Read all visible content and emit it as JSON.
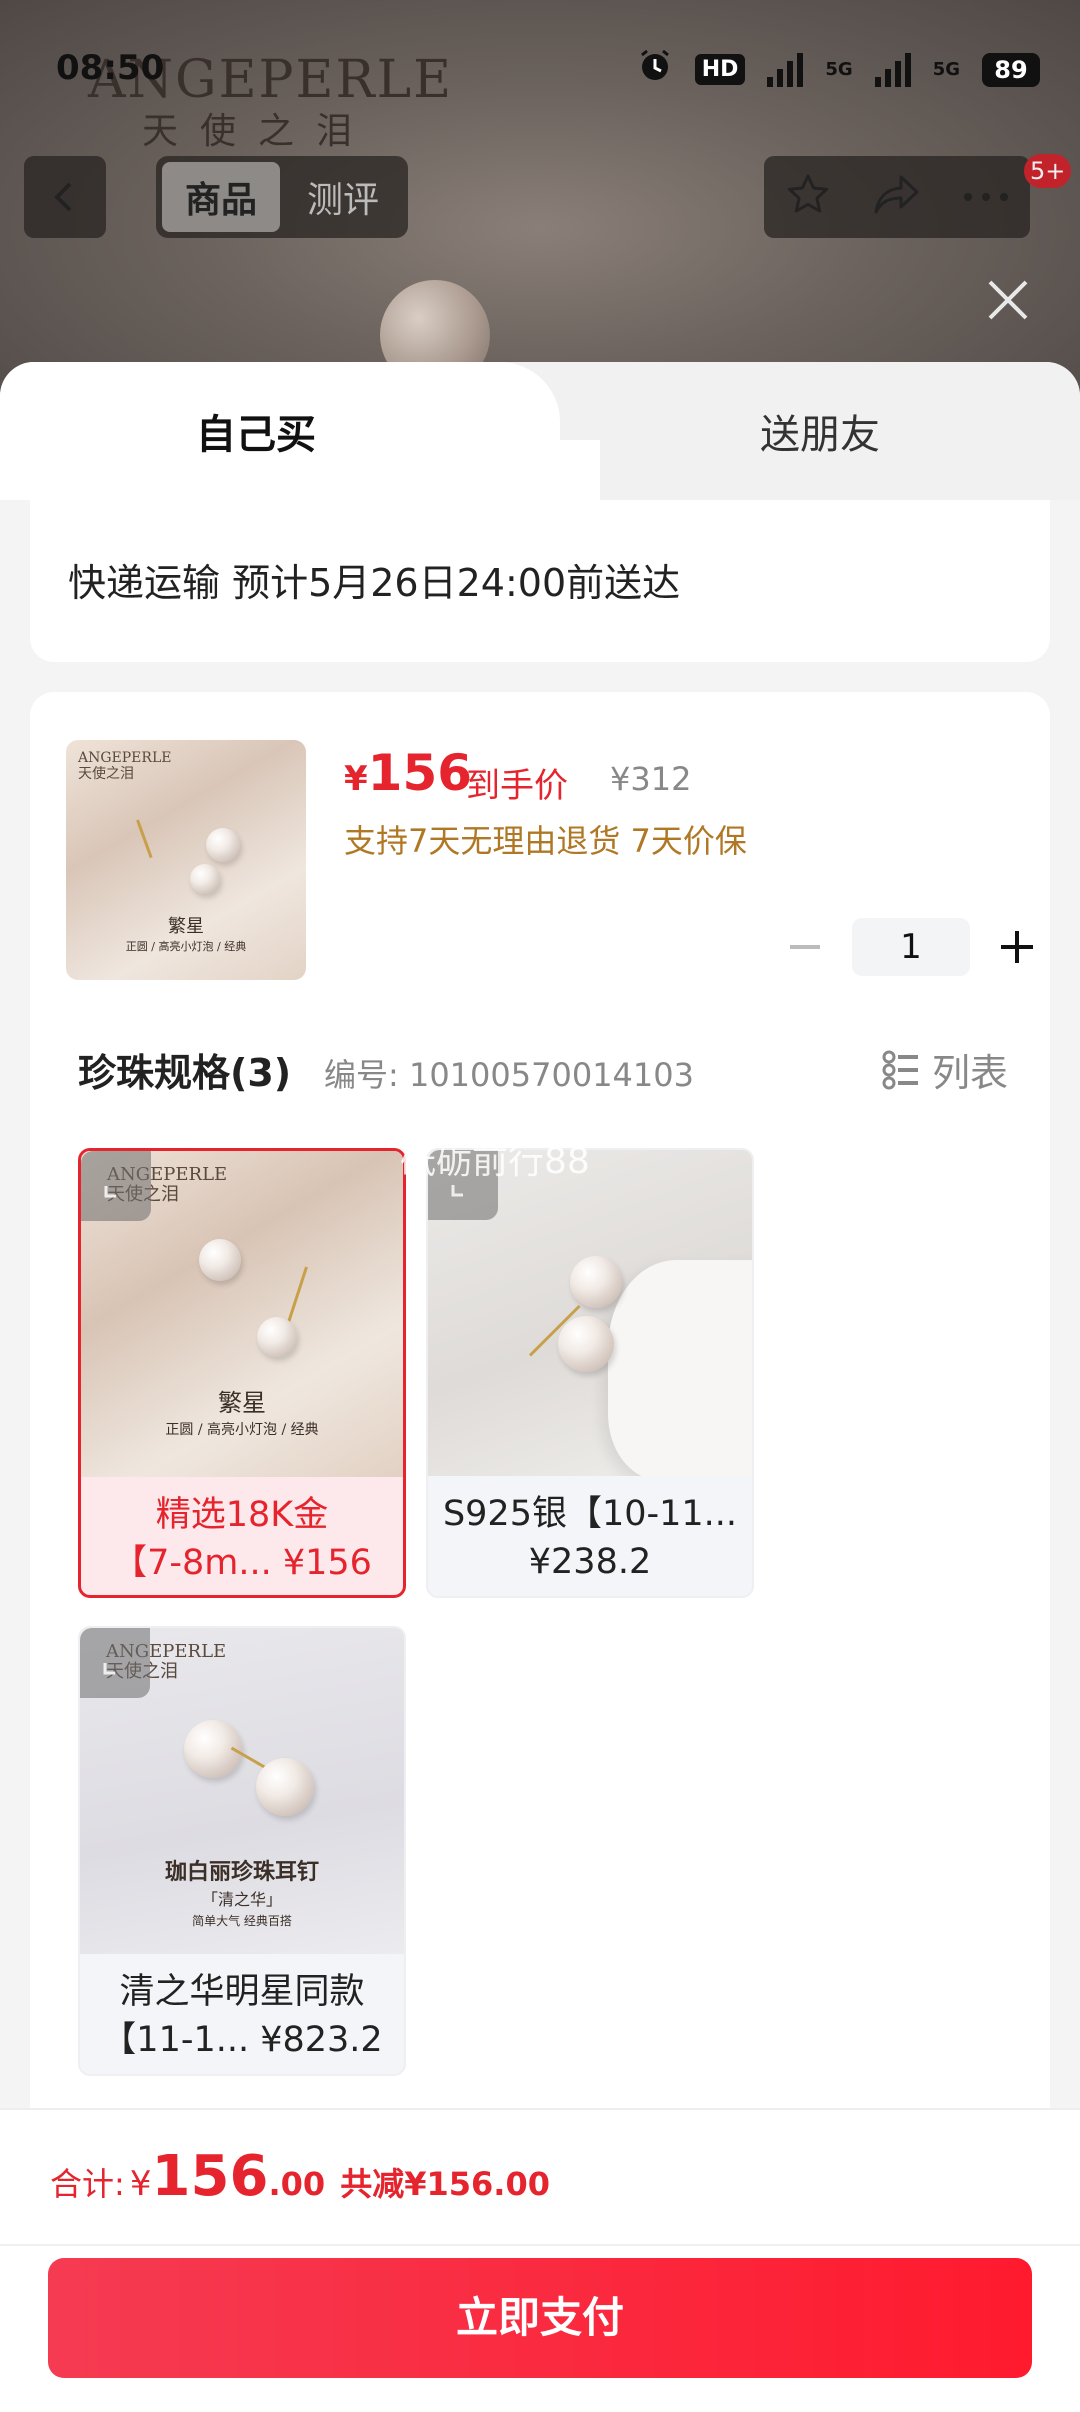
{
  "status_bar": {
    "time": "08:50",
    "signal1_label": "5G",
    "signal2_label": "5G",
    "hd_label": "HD",
    "battery": "89"
  },
  "background": {
    "brand_en": "ANGEPERLE",
    "brand_cn": "天使之泪"
  },
  "nav": {
    "segments": [
      "商品",
      "测评"
    ],
    "active_segment": 0,
    "badge": "5+"
  },
  "tabs": {
    "self_buy": "自己买",
    "send_friend": "送朋友"
  },
  "delivery": {
    "text": "快递运输 预计5月26日24:00前送达"
  },
  "product": {
    "price_yen": "¥",
    "price": "156",
    "price_tag": "到手价",
    "original_price": "¥312",
    "guarantee": "支持7天无理由退货 7天价保",
    "thumb_brand_en": "ANGEPERLE",
    "thumb_brand_cn": "天使之泪",
    "thumb_title": "繁星",
    "thumb_sub": "正圆 / 高亮小灯泡 / 经典",
    "quantity": "1"
  },
  "spec": {
    "title": "珍珠规格(3)",
    "code": "编号: 10100570014103",
    "list_label": "列表"
  },
  "options": [
    {
      "line1": "精选18K金",
      "line2": "【7-8m... ¥156",
      "img_title": "繁星",
      "img_sub": "正圆 / 高亮小灯泡 / 经典",
      "brand_en": "ANGEPERLE",
      "brand_cn": "天使之泪",
      "selected": true
    },
    {
      "line1": "S925银【10-11...",
      "line2": "¥238.2",
      "selected": false
    },
    {
      "line1": "清之华明星同款",
      "line2": "【11-1... ¥823.2",
      "img_title": "珈白丽珍珠耳钉",
      "img_sub": "「清之华」",
      "img_sub2": "简单大气 经典百搭",
      "brand_en": "ANGEPERLE",
      "brand_cn": "天使之泪",
      "selected": false
    }
  ],
  "watermark": "砥砺前行88",
  "footer": {
    "total_label": "合计:",
    "total_yen": "¥",
    "total_int": "156",
    "total_dec": ".00",
    "saved": "共减¥156.00",
    "pay_button": "立即支付"
  },
  "colors": {
    "accent": "#e5242e",
    "guarantee": "#b07824",
    "pay_start": "#f53b52",
    "pay_end": "#ff1a2e"
  }
}
